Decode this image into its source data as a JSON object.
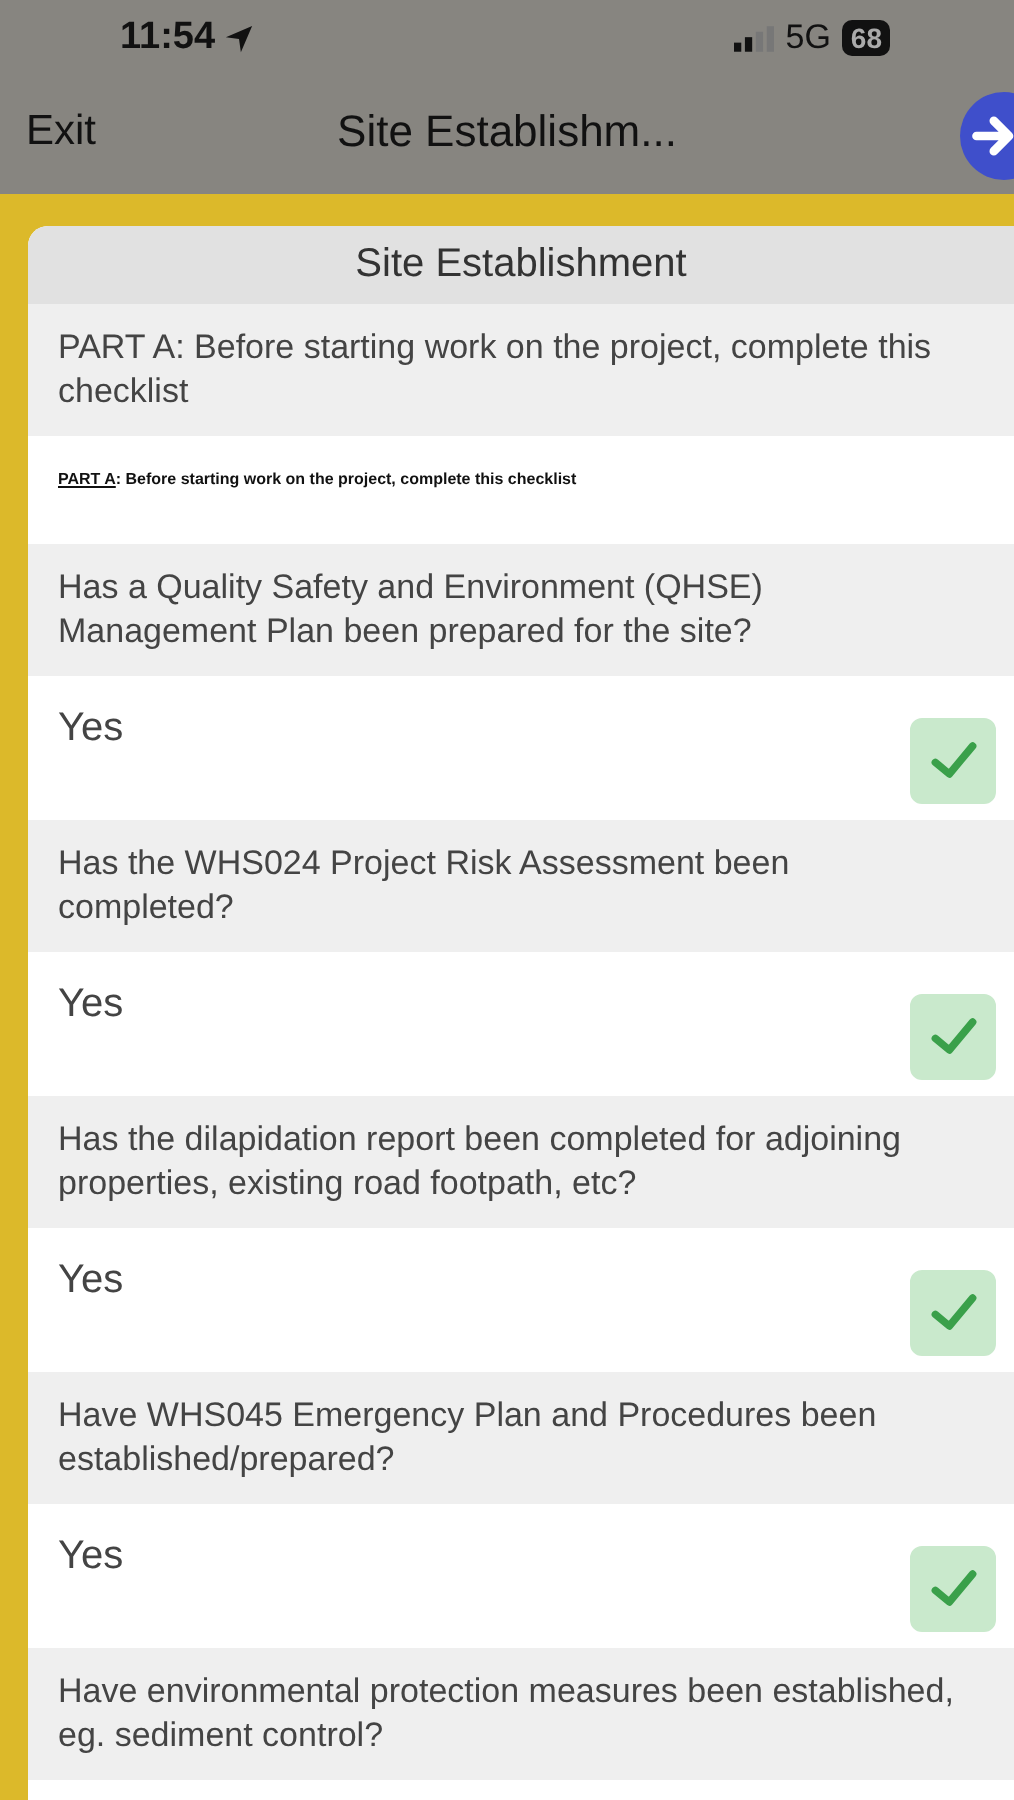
{
  "status_bar": {
    "time": "11:54",
    "network": "5G",
    "battery": "68"
  },
  "nav_bar": {
    "back": "Exit",
    "title": "Site Establishm..."
  },
  "form": {
    "title": "Site Establishment",
    "items": [
      {
        "kind": "section",
        "text": "PART A: Before starting work on the project, complete this checklist"
      },
      {
        "kind": "document",
        "heading": "PART A",
        "text": ": Before starting work on the project, complete this checklist"
      },
      {
        "kind": "question",
        "text": "Has a Quality Safety and Environment (QHSE) Management Plan been prepared for the site?",
        "answer": "Yes",
        "checked": true
      },
      {
        "kind": "question",
        "text": "Has the WHS024 Project Risk Assessment been completed?",
        "answer": "Yes",
        "checked": true
      },
      {
        "kind": "question",
        "text": "Has the dilapidation report been completed for adjoining properties, existing road footpath, etc?",
        "answer": "Yes",
        "checked": true
      },
      {
        "kind": "question",
        "text": "Have WHS045 Emergency Plan and Procedures been established/prepared?",
        "answer": "Yes",
        "checked": true
      },
      {
        "kind": "question",
        "text": "Have environmental protection measures been established, eg. sediment control?"
      }
    ]
  }
}
